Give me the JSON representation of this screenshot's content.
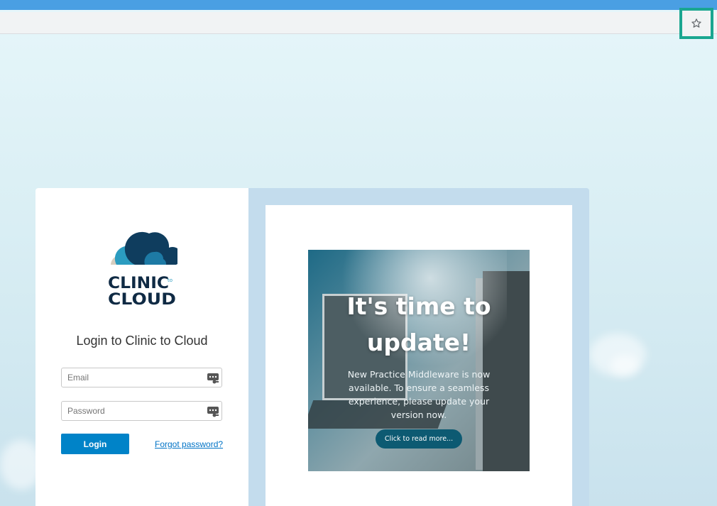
{
  "browser": {
    "bookmark_icon": "star-outline-icon",
    "accent": "#4a9fe3",
    "highlight_color": "#1aa690"
  },
  "login": {
    "brand": {
      "line1": "CLINIC",
      "to": "to",
      "line2": "CLOUD"
    },
    "title": "Login to Clinic to Cloud",
    "email_placeholder": "Email",
    "password_placeholder": "Password",
    "login_label": "Login",
    "forgot_label": "Forgot password?",
    "button_color": "#0083c8"
  },
  "promo": {
    "heading_line1": "It's time to",
    "heading_line2": "update!",
    "body": "New Practice Middleware is now available. To ensure a seamless experience, please update your version now.",
    "cta_label": "Click to read more..."
  }
}
